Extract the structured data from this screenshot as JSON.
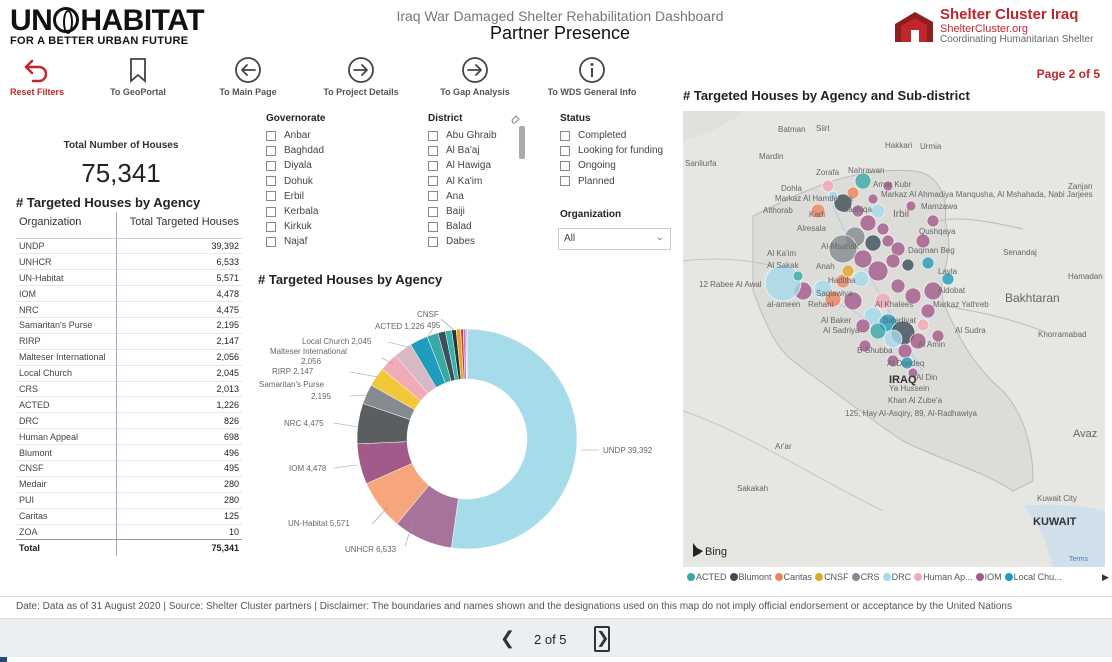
{
  "header": {
    "logo_text": "UN HABITAT",
    "logo_tagline": "FOR A BETTER URBAN FUTURE",
    "title": "Iraq War Damaged Shelter Rehabilitation Dashboard",
    "subtitle": "Partner Presence",
    "cluster_name": "Shelter Cluster Iraq",
    "cluster_url": "ShelterCluster.org",
    "cluster_tagline": "Coordinating Humanitarian Shelter"
  },
  "nav": {
    "reset": "Reset Filters",
    "geoportal": "To GeoPortal",
    "main": "To Main Page",
    "project": "To Project Details",
    "gap": "To Gap Analysis",
    "wds": "To WDS General Info",
    "page_indicator": "Page 2 of 5"
  },
  "summary": {
    "total_label": "Total Number of Houses",
    "total_value": "75,341"
  },
  "agency_table": {
    "title": "# Targeted Houses by Agency",
    "columns": [
      "Organization",
      "Total Targeted Houses"
    ],
    "rows": [
      {
        "org": "UNDP",
        "val": "39,392"
      },
      {
        "org": "UNHCR",
        "val": "6,533"
      },
      {
        "org": "UN-Habitat",
        "val": "5,571"
      },
      {
        "org": "IOM",
        "val": "4,478"
      },
      {
        "org": "NRC",
        "val": "4,475"
      },
      {
        "org": "Samaritan's Purse",
        "val": "2,195"
      },
      {
        "org": "RIRP",
        "val": "2,147"
      },
      {
        "org": "Malteser International",
        "val": "2,056"
      },
      {
        "org": "Local Church",
        "val": "2,045"
      },
      {
        "org": "CRS",
        "val": "2,013"
      },
      {
        "org": "ACTED",
        "val": "1,226"
      },
      {
        "org": "DRC",
        "val": "826"
      },
      {
        "org": "Human Appeal",
        "val": "698"
      },
      {
        "org": "Blumont",
        "val": "496"
      },
      {
        "org": "CNSF",
        "val": "495"
      },
      {
        "org": "Medair",
        "val": "280"
      },
      {
        "org": "PUI",
        "val": "280"
      },
      {
        "org": "Caritas",
        "val": "125"
      },
      {
        "org": "ZOA",
        "val": "10"
      }
    ],
    "total_label": "Total",
    "total_value": "75,341"
  },
  "filters": {
    "governorate": {
      "label": "Governorate",
      "options": [
        "Anbar",
        "Baghdad",
        "Diyala",
        "Dohuk",
        "Erbil",
        "Kerbala",
        "Kirkuk",
        "Najaf"
      ]
    },
    "district": {
      "label": "District",
      "options": [
        "Abu Ghraib",
        "Al Ba'aj",
        "Al Hawiga",
        "Al Ka'im",
        "Ana",
        "Baiji",
        "Balad",
        "Dabes"
      ]
    },
    "status": {
      "label": "Status",
      "options": [
        "Completed",
        "Looking for funding",
        "Ongoing",
        "Planned"
      ]
    },
    "organization": {
      "label": "Organization",
      "value": "All"
    }
  },
  "donut": {
    "title": "# Targeted Houses by Agency",
    "labels": {
      "undp": "UNDP 39,392",
      "unhcr": "UNHCR 6,533",
      "unhabitat": "UN-Habitat 5,571",
      "iom": "IOM 4,478",
      "nrc": "NRC 4,475",
      "sp1": "Samaritan's Purse",
      "sp2": "2,195",
      "rirp": "RIRP 2,147",
      "malt1": "Malteser International",
      "malt2": "2,056",
      "church": "Local Church 2,045",
      "acted": "ACTED 1,226",
      "cnsf1": "CNSF",
      "cnsf2": "495"
    }
  },
  "chart_data": {
    "type": "pie",
    "title": "# Targeted Houses by Agency",
    "categories": [
      "UNDP",
      "UNHCR",
      "UN-Habitat",
      "IOM",
      "NRC",
      "Samaritan's Purse",
      "RIRP",
      "Malteser International",
      "Local Church",
      "CRS",
      "ACTED",
      "DRC",
      "Human Appeal",
      "Blumont",
      "CNSF",
      "Medair",
      "PUI",
      "Caritas",
      "ZOA"
    ],
    "values": [
      39392,
      6533,
      5571,
      4478,
      4475,
      2195,
      2147,
      2056,
      2045,
      2013,
      1226,
      826,
      698,
      496,
      495,
      280,
      280,
      125,
      10
    ],
    "colors": [
      "#a6dbea",
      "#a8739a",
      "#f7a57d",
      "#a25a8a",
      "#5a5e61",
      "#858b90",
      "#f2c83a",
      "#f2a9b8",
      "#d7b8c5",
      "#1f9cbe",
      "#3aa9a6",
      "#3f4e58",
      "#2fb5ad",
      "#303233",
      "#e0a82b",
      "#cc3b4c",
      "#b47bd0",
      "#f0835f",
      "#444444"
    ]
  },
  "map": {
    "title": "# Targeted Houses by Agency and Sub-district",
    "places": [
      "Batman",
      "Siirt",
      "Hakkari",
      "Urmia",
      "Mardin",
      "Zorafa",
      "Nahrawan",
      "Dohla",
      "Amar Kubr",
      "Markaz Al Hamdaniya",
      "Markaz Al Ahmadiya Manqusha, Al Mshahada, Nabi Jarjees",
      "Zanjan",
      "Mamzawa",
      "Althorab",
      "Kadi",
      "Bashiqa",
      "Irbil",
      "Qushqaya",
      "Alresala",
      "Al-Msahak",
      "Daqman Beg",
      "Senandaj",
      "Al Ka'im",
      "Hamadan",
      "Al Sakak",
      "Anah",
      "Layla",
      "12 Rabee Al Awal",
      "Haditha",
      "Saqlawiya",
      "Aldobat",
      "Bakhtaran",
      "al-ameen",
      "Rehani",
      "Al Khalees",
      "Markaz Yathreb",
      "Al Baker",
      "Baladiyat",
      "Al Sadriya",
      "Khorramabad",
      "B-Shubba",
      "Al Amin",
      "Al Sudra",
      "Al Doodeq",
      "IRAQ",
      "Al Din",
      "Ya Hussein",
      "Khan Al Zube'a",
      "125, Hay Al-Asqiry, 89, Al-Radhawiya",
      "Avaz",
      "Ar'ar",
      "Sakakah",
      "Kuwait City",
      "KUWAIT",
      "Sanliurfa"
    ],
    "bing": "Bing",
    "terms": "Terms",
    "legend": [
      "ACTED",
      "Blumont",
      "Caritas",
      "CNSF",
      "CRS",
      "DRC",
      "Human Ap...",
      "IOM",
      "Local Chu..."
    ],
    "legend_colors": [
      "#3aa9a6",
      "#3f4e58",
      "#f0835f",
      "#e0a82b",
      "#858b90",
      "#a6dbea",
      "#f2a9b8",
      "#a25a8a",
      "#1f9cbe"
    ]
  },
  "footer": {
    "text": "Date: Data as of  31 August 2020   |   Source: Shelter Cluster partners   |   Disclaimer: The boundaries and names shown and the designations used on this map do not imply official endorsement or acceptance by the United Nations"
  },
  "pager": {
    "text": "2 of 5"
  }
}
